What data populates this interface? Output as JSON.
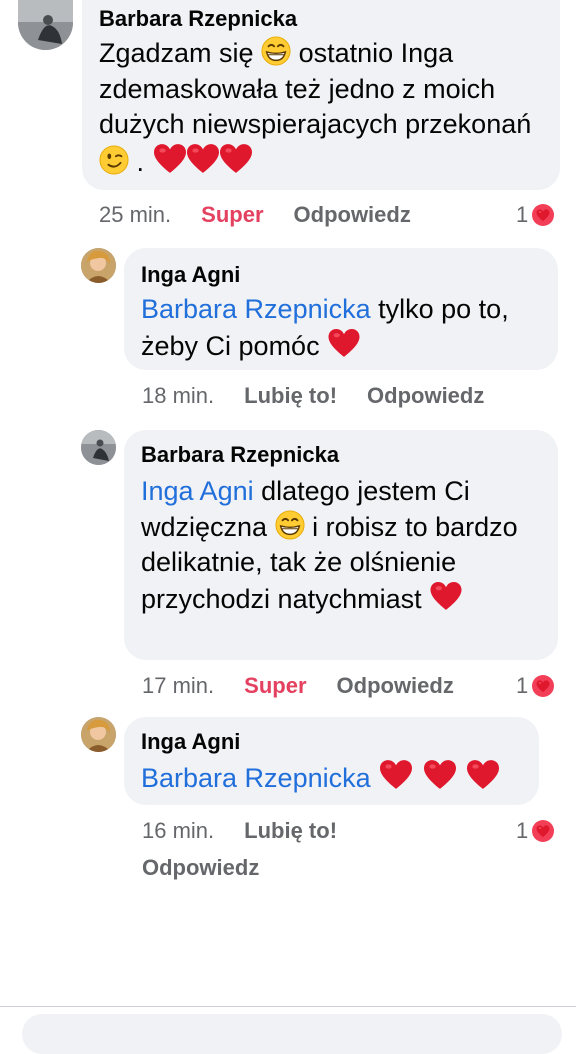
{
  "comments": [
    {
      "author": "Barbara Rzepnicka",
      "parts": [
        "Zgadzam się ",
        " ostatnio Inga zdemaskowała też jedno z moich dużych niewspierajacych przekonań ",
        " . "
      ],
      "time": "25 min.",
      "reaction_label": "Super",
      "reply_label": "Odpowiedz",
      "reaction_count": "1"
    },
    {
      "author": "Inga Agni",
      "mention": "Barbara Rzepnicka",
      "text": " tylko po to, żeby Ci pomóc ",
      "time": "18 min.",
      "like_label": "Lubię to!",
      "reply_label": "Odpowiedz"
    },
    {
      "author": "Barbara Rzepnicka",
      "mention": "Inga Agni",
      "text_a": " dlatego jestem Ci wdzięczna ",
      "text_b": " i robisz to bardzo delikatnie, tak że olśnienie przychodzi natychmiast ",
      "time": "17 min.",
      "reaction_label": "Super",
      "reply_label": "Odpowiedz",
      "reaction_count": "1"
    },
    {
      "author": "Inga Agni",
      "mention": "Barbara Rzepnicka",
      "time": "16 min.",
      "like_label": "Lubię to!",
      "reply_label": "Odpowiedz",
      "reaction_count": "1"
    }
  ],
  "icons": {
    "heart": "heart-icon",
    "grin": "grinning-face-icon",
    "wink": "winking-face-icon"
  },
  "colors": {
    "mention": "#216fdb",
    "super": "#e4405f",
    "heart": "#e0182d",
    "bubble": "#f0f2f5"
  }
}
